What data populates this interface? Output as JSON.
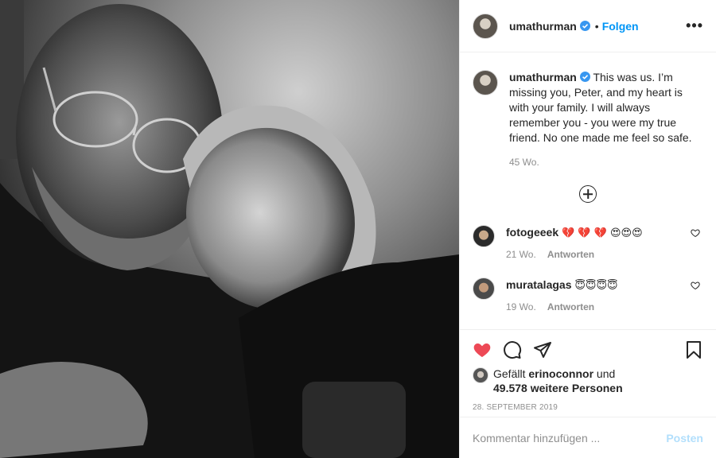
{
  "post": {
    "username": "umathurman",
    "follow_label": "Folgen",
    "separator": "•",
    "more_label": "•••",
    "caption": "This was us. I’m missing you, Peter, and my heart is with your family. I will always remember you - you were my true friend. No one made me feel so safe.",
    "caption_age": "45 Wo.",
    "comments": [
      {
        "username": "fotogeeek",
        "text": "💔 💔 💔 😍😍😍",
        "age": "21 Wo.",
        "reply_label": "Antworten"
      },
      {
        "username": "muratalagas",
        "text": "😇😇😇😇",
        "age": "19 Wo.",
        "reply_label": "Antworten"
      }
    ],
    "likes": {
      "prefix": "Gefällt",
      "liked_by": "erinoconnor",
      "connector": "und",
      "others": "49.578 weitere Personen"
    },
    "date": "28. September 2019",
    "add_comment_placeholder": "Kommentar hinzufügen ...",
    "post_button": "Posten"
  },
  "colors": {
    "accent": "#0095f6",
    "like_red": "#ed4956",
    "muted": "#8e8e8e",
    "post_disabled": "#b2dffc"
  },
  "icons": [
    "verified-badge-icon",
    "more-options-icon",
    "load-more-comments-icon",
    "like-comment-icon",
    "like-icon",
    "comment-icon",
    "share-icon",
    "save-icon"
  ]
}
